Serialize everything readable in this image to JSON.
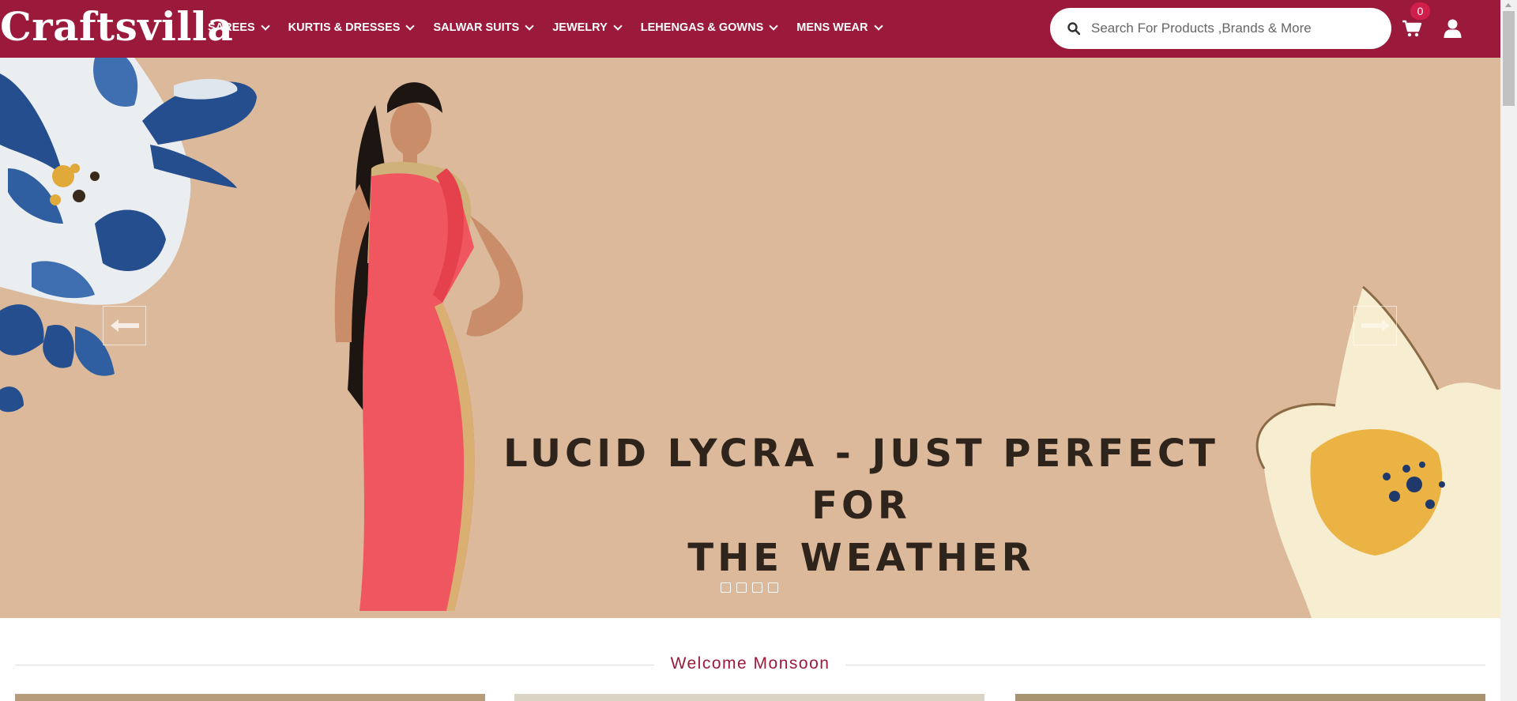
{
  "header": {
    "logo_text": "Craftsvilla",
    "nav": [
      {
        "label": "SAREES"
      },
      {
        "label": "KURTIS & DRESSES"
      },
      {
        "label": "SALWAR SUITS"
      },
      {
        "label": "JEWELRY"
      },
      {
        "label": "LEHENGAS & GOWNS"
      },
      {
        "label": "MENS WEAR"
      }
    ],
    "search": {
      "placeholder": "Search For Products ,Brands & More",
      "value": ""
    },
    "cart_count": "0",
    "icons": {
      "search": "search-icon",
      "cart": "cart-icon",
      "user": "user-icon"
    }
  },
  "hero": {
    "caption_line1": "LUCID LYCRA - JUST PERFECT FOR",
    "caption_line2": "THE WEATHER",
    "slide_count": 4,
    "active_slide": 1,
    "icons": {
      "prev": "arrow-left-icon",
      "next": "arrow-right-icon"
    }
  },
  "section": {
    "title": "Welcome Monsoon"
  },
  "colors": {
    "brand": "#9b1a3c",
    "badge": "#d11f4c",
    "hero_bg": "#dbb99a",
    "hero_text": "#2e241c"
  }
}
